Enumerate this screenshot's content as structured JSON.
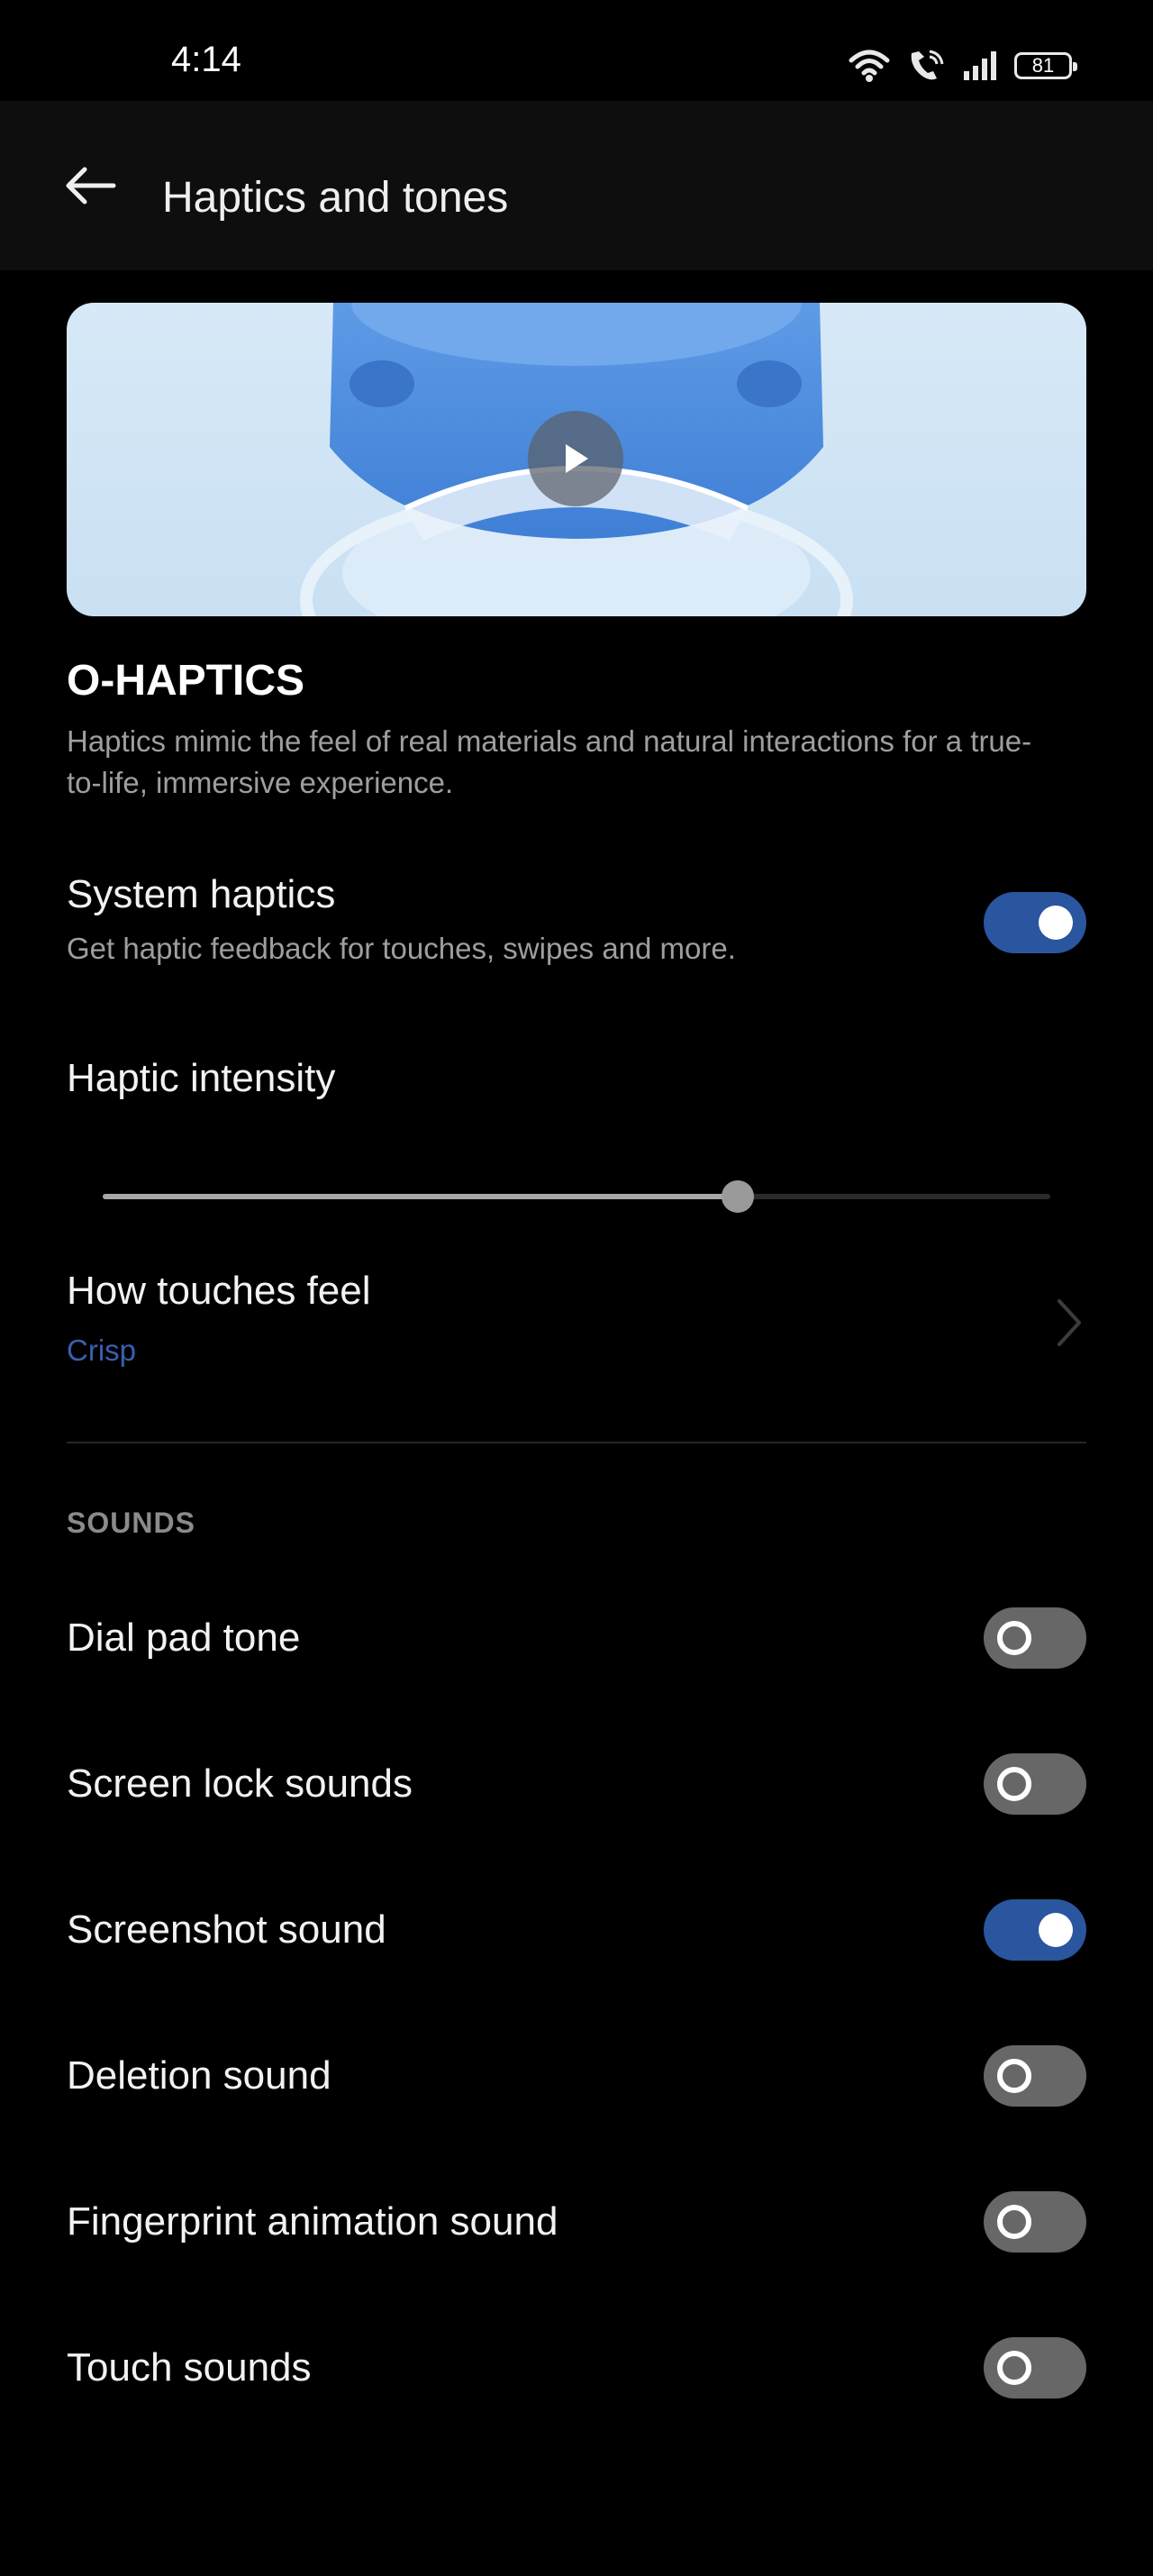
{
  "status_bar": {
    "time": "4:14",
    "battery": "81",
    "icons": [
      "wifi-icon",
      "wifi-calling-icon",
      "signal-icon",
      "battery-icon"
    ]
  },
  "app_bar": {
    "title": "Haptics and tones",
    "back_icon": "arrow-left-icon"
  },
  "hero": {
    "play_icon": "play-icon"
  },
  "o_haptics": {
    "title": "O-HAPTICS",
    "description": "Haptics mimic the feel of real materials and natural interactions for a true-to-life, immersive experience."
  },
  "system_haptics": {
    "title": "System haptics",
    "subtitle": "Get haptic feedback for touches, swipes and more.",
    "enabled": true
  },
  "haptic_intensity": {
    "title": "Haptic intensity",
    "level": 0.67
  },
  "touch_feel": {
    "title": "How touches feel",
    "value": "Crisp"
  },
  "sounds": {
    "header": "SOUNDS",
    "items": [
      {
        "label": "Dial pad tone",
        "enabled": false
      },
      {
        "label": "Screen lock sounds",
        "enabled": false
      },
      {
        "label": "Screenshot sound",
        "enabled": true
      },
      {
        "label": "Deletion sound",
        "enabled": false
      },
      {
        "label": "Fingerprint animation sound",
        "enabled": false
      },
      {
        "label": "Touch sounds",
        "enabled": false
      }
    ]
  },
  "colors": {
    "accent": "#2a559f",
    "link": "#3a5fae",
    "toggle_off": "#676767",
    "background": "#000000"
  }
}
